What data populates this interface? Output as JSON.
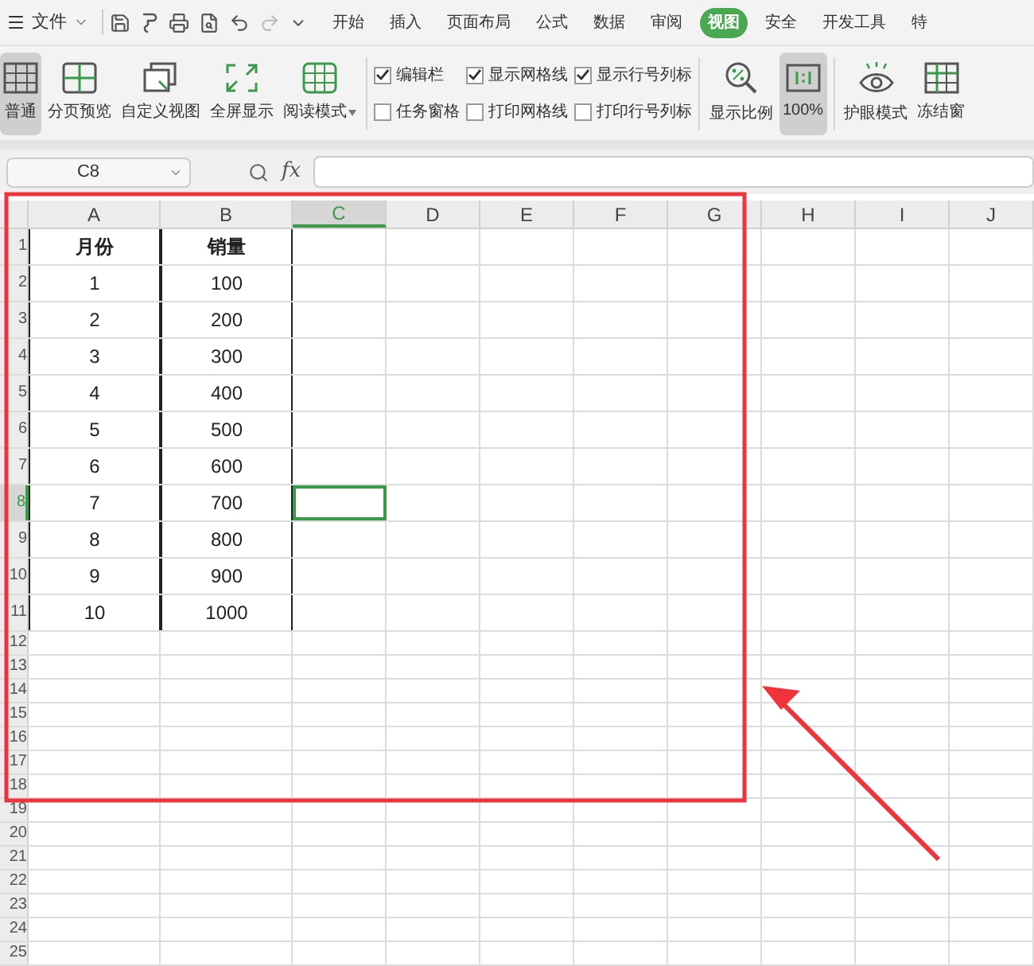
{
  "menu": {
    "label": "文件"
  },
  "tabs": [
    {
      "label": "开始",
      "selected": false
    },
    {
      "label": "插入",
      "selected": false
    },
    {
      "label": "页面布局",
      "selected": false
    },
    {
      "label": "公式",
      "selected": false
    },
    {
      "label": "数据",
      "selected": false
    },
    {
      "label": "审阅",
      "selected": false
    },
    {
      "label": "视图",
      "selected": true
    },
    {
      "label": "安全",
      "selected": false
    },
    {
      "label": "开发工具",
      "selected": false
    },
    {
      "label": "特",
      "selected": false
    }
  ],
  "view_buttons": [
    {
      "label": "普通",
      "selected": true,
      "kind": "grid"
    },
    {
      "label": "分页预览",
      "selected": false,
      "kind": "pages"
    },
    {
      "label": "自定义视图",
      "selected": false,
      "kind": "custom"
    },
    {
      "label": "全屏显示",
      "selected": false,
      "kind": "fullscreen"
    },
    {
      "label": "阅读模式",
      "selected": false,
      "kind": "reading",
      "dropdown": true
    }
  ],
  "checkboxes": [
    {
      "label": "编辑栏",
      "checked": true
    },
    {
      "label": "任务窗格",
      "checked": false
    },
    {
      "label": "显示网格线",
      "checked": true
    },
    {
      "label": "打印网格线",
      "checked": false
    },
    {
      "label": "显示行号列标",
      "checked": true
    },
    {
      "label": "打印行号列标",
      "checked": false
    }
  ],
  "zoom_buttons": [
    {
      "label": "显示比例",
      "selected": false,
      "kind": "zoom"
    },
    {
      "label": "100%",
      "selected": true,
      "kind": "ratio"
    }
  ],
  "extra_buttons": [
    {
      "label": "护眼模式",
      "kind": "eye"
    },
    {
      "label": "冻结窗",
      "kind": "freeze"
    }
  ],
  "name_box": {
    "value": "C8"
  },
  "formula_bar": {
    "label": "fx"
  },
  "columns": [
    {
      "label": "A",
      "selected": false
    },
    {
      "label": "B",
      "selected": false
    },
    {
      "label": "C",
      "selected": true
    },
    {
      "label": "D",
      "selected": false
    },
    {
      "label": "E",
      "selected": false
    },
    {
      "label": "F",
      "selected": false
    },
    {
      "label": "G",
      "selected": false
    },
    {
      "label": "H",
      "selected": false
    },
    {
      "label": "I",
      "selected": false
    },
    {
      "label": "J",
      "selected": false
    }
  ],
  "rows": [
    {
      "label": "1",
      "selected": false,
      "cells": [
        {
          "text": "月份",
          "selected": false
        },
        {
          "text": "销量",
          "selected": false
        }
      ]
    },
    {
      "label": "2",
      "selected": false,
      "cells": [
        {
          "text": "1",
          "selected": false
        },
        {
          "text": "100",
          "selected": false
        }
      ]
    },
    {
      "label": "3",
      "selected": false,
      "cells": [
        {
          "text": "2",
          "selected": false
        },
        {
          "text": "200",
          "selected": false
        }
      ]
    },
    {
      "label": "4",
      "selected": false,
      "cells": [
        {
          "text": "3",
          "selected": false
        },
        {
          "text": "300",
          "selected": false
        }
      ]
    },
    {
      "label": "5",
      "selected": false,
      "cells": [
        {
          "text": "4",
          "selected": false
        },
        {
          "text": "400",
          "selected": false
        }
      ]
    },
    {
      "label": "6",
      "selected": false,
      "cells": [
        {
          "text": "5",
          "selected": false
        },
        {
          "text": "500",
          "selected": false
        }
      ]
    },
    {
      "label": "7",
      "selected": false,
      "cells": [
        {
          "text": "6",
          "selected": false
        },
        {
          "text": "600",
          "selected": false
        }
      ]
    },
    {
      "label": "8",
      "selected": true,
      "cells": [
        {
          "text": "7",
          "selected": false
        },
        {
          "text": "700",
          "selected": false
        },
        {
          "selected": true
        }
      ]
    },
    {
      "label": "9",
      "selected": false,
      "cells": [
        {
          "text": "8",
          "selected": false
        },
        {
          "text": "800",
          "selected": false
        }
      ]
    },
    {
      "label": "10",
      "selected": false,
      "cells": [
        {
          "text": "9",
          "selected": false
        },
        {
          "text": "900",
          "selected": false
        }
      ]
    },
    {
      "label": "11",
      "selected": false,
      "cells": [
        {
          "text": "10",
          "selected": false
        },
        {
          "text": "1000",
          "selected": false
        }
      ]
    },
    {
      "label": "12",
      "selected": false
    },
    {
      "label": "13",
      "selected": false
    },
    {
      "label": "14",
      "selected": false
    },
    {
      "label": "15",
      "selected": false
    },
    {
      "label": "16",
      "selected": false
    },
    {
      "label": "17",
      "selected": false
    },
    {
      "label": "18",
      "selected": false
    },
    {
      "label": "19",
      "selected": false
    },
    {
      "label": "20",
      "selected": false
    },
    {
      "label": "21",
      "selected": false
    },
    {
      "label": "22",
      "selected": false
    },
    {
      "label": "23",
      "selected": false
    },
    {
      "label": "24",
      "selected": false
    },
    {
      "label": "25",
      "selected": false
    }
  ]
}
